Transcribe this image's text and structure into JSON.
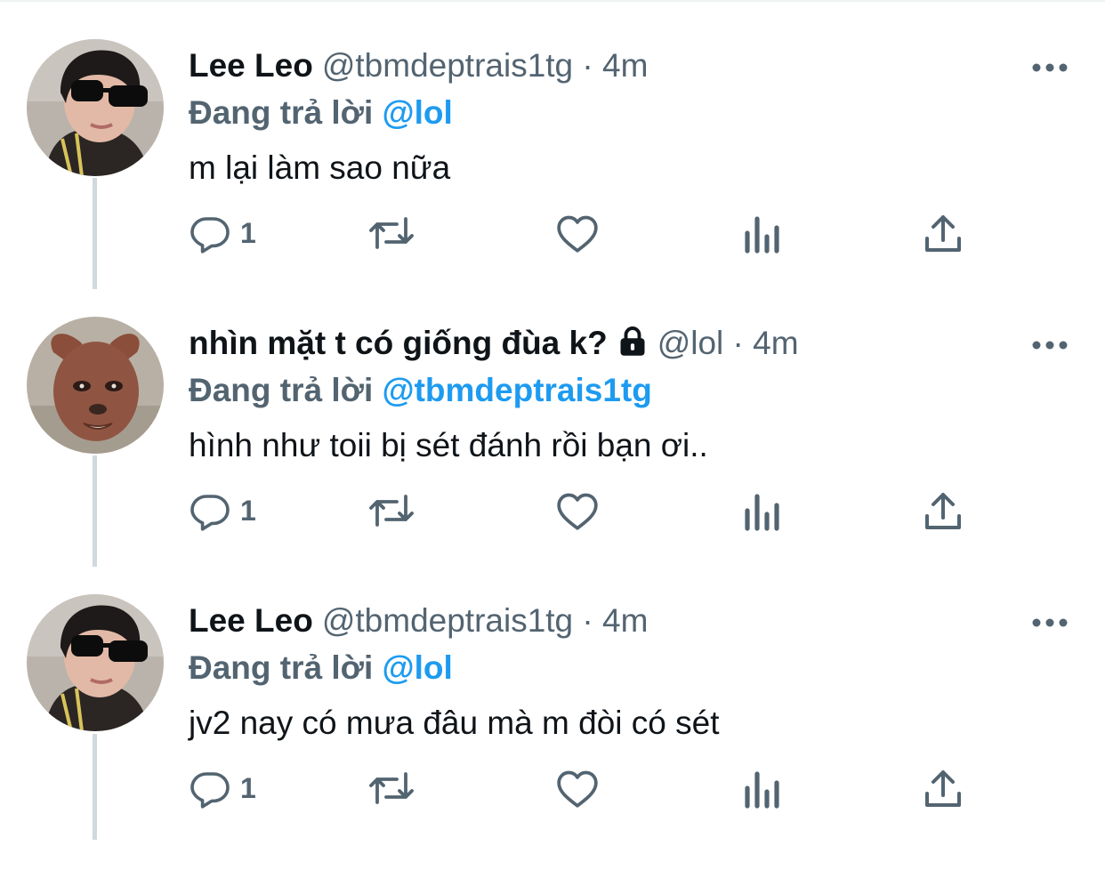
{
  "colors": {
    "mention": "#1d9bf0",
    "secondary": "#536471",
    "text": "#0f1419",
    "thread_line": "#cfd9de"
  },
  "tweets": [
    {
      "display_name": "Lee Leo",
      "meta": "@tbmdeptrais1tg · 4m",
      "locked": false,
      "reply_prefix": "Đang trả lời",
      "reply_to": "@lol",
      "text": "m lại làm sao nữa",
      "reply_count": "1",
      "avatar": "avatar-lee-leo"
    },
    {
      "display_name": "nhìn mặt t có giống đùa k?",
      "meta": "@lol · 4m",
      "locked": true,
      "reply_prefix": "Đang trả lời",
      "reply_to": "@tbmdeptrais1tg",
      "text": "hình như toii bị sét đánh rồi bạn ơi..",
      "reply_count": "1",
      "avatar": "avatar-dog-face"
    },
    {
      "display_name": "Lee Leo",
      "meta": "@tbmdeptrais1tg · 4m",
      "locked": false,
      "reply_prefix": "Đang trả lời",
      "reply_to": "@lol",
      "text": "jv2 nay có mưa đâu mà m đòi có sét",
      "reply_count": "1",
      "avatar": "avatar-lee-leo"
    }
  ],
  "icons": {
    "more": "more-horizontal-icon",
    "reply": "reply-bubble-icon",
    "retweet": "retweet-icon",
    "like": "heart-icon",
    "views": "analytics-icon",
    "share": "share-upload-icon",
    "lock": "lock-icon"
  }
}
